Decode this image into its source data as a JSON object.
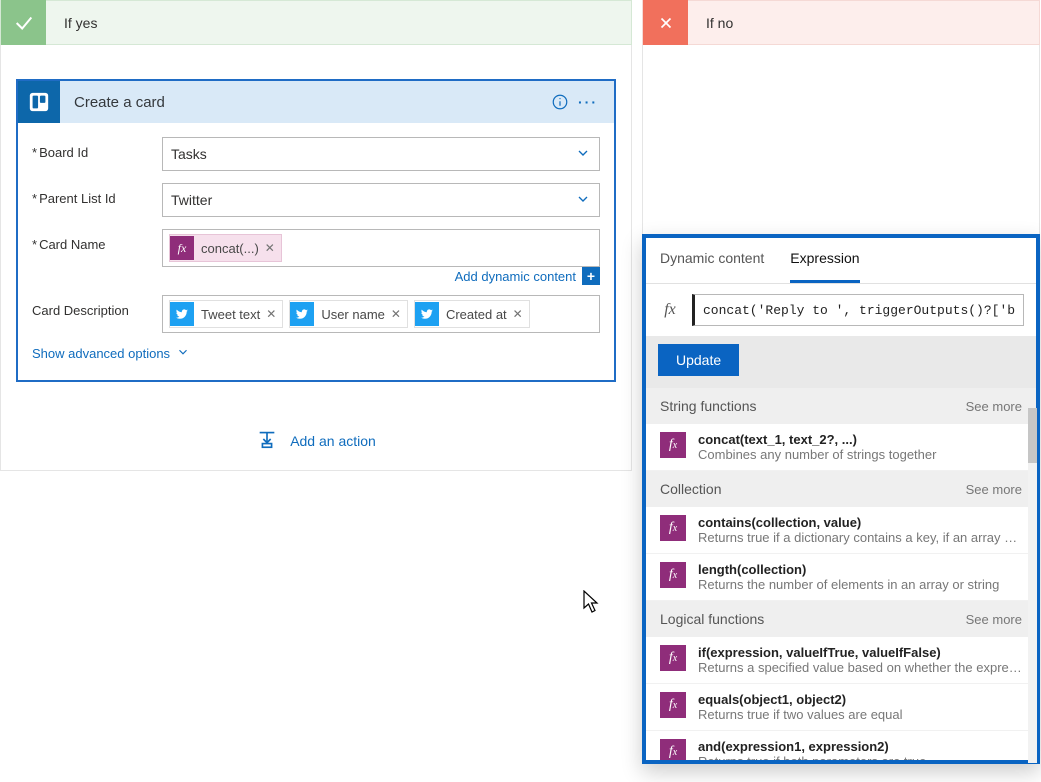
{
  "branches": {
    "yes": {
      "title": "If yes"
    },
    "no": {
      "title": "If no"
    }
  },
  "action": {
    "title": "Create a card",
    "fields": {
      "board_id_label": "Board Id",
      "board_id_value": "Tasks",
      "parent_list_id_label": "Parent List Id",
      "parent_list_id_value": "Twitter",
      "card_name_label": "Card Name",
      "card_name_token": "concat(...)",
      "card_description_label": "Card Description"
    },
    "description_tokens": [
      {
        "label": "Tweet text",
        "icon": "twitter"
      },
      {
        "label": "User name",
        "icon": "twitter"
      },
      {
        "label": "Created at",
        "icon": "twitter"
      }
    ],
    "add_dynamic_content": "Add dynamic content",
    "show_advanced": "Show advanced options"
  },
  "add_action": "Add an action",
  "expression_panel": {
    "tabs": {
      "dynamic": "Dynamic content",
      "expression": "Expression"
    },
    "active_tab": "expression",
    "fx_label": "fx",
    "input_value": "concat('Reply to ', triggerOutputs()?['bod",
    "update_label": "Update",
    "groups": [
      {
        "title": "String functions",
        "see_more": "See more",
        "items": [
          {
            "sig": "concat(text_1, text_2?, ...)",
            "desc": "Combines any number of strings together"
          }
        ]
      },
      {
        "title": "Collection",
        "see_more": "See more",
        "items": [
          {
            "sig": "contains(collection, value)",
            "desc": "Returns true if a dictionary contains a key, if an array cont..."
          },
          {
            "sig": "length(collection)",
            "desc": "Returns the number of elements in an array or string"
          }
        ]
      },
      {
        "title": "Logical functions",
        "see_more": "See more",
        "items": [
          {
            "sig": "if(expression, valueIfTrue, valueIfFalse)",
            "desc": "Returns a specified value based on whether the expressio..."
          },
          {
            "sig": "equals(object1, object2)",
            "desc": "Returns true if two values are equal"
          },
          {
            "sig": "and(expression1, expression2)",
            "desc": "Returns true if both parameters are true"
          }
        ]
      }
    ]
  }
}
